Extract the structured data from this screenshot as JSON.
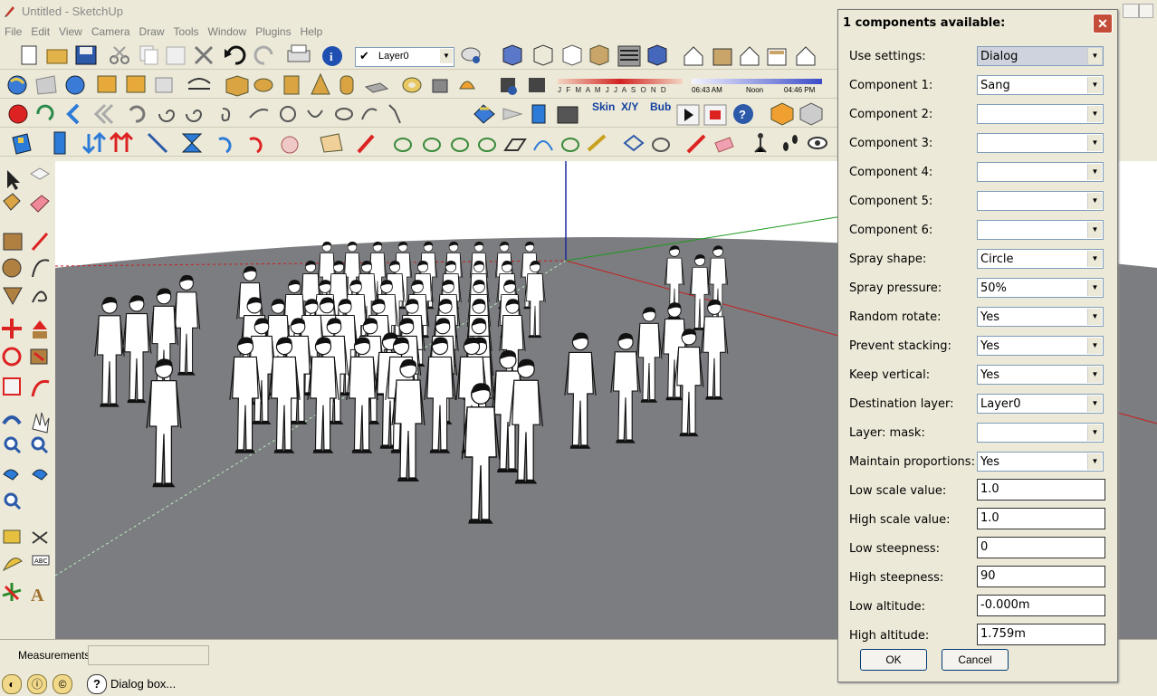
{
  "window": {
    "title": "Untitled - SketchUp"
  },
  "menu": [
    "File",
    "Edit",
    "View",
    "Camera",
    "Draw",
    "Tools",
    "Window",
    "Plugins",
    "Help"
  ],
  "toolbar": {
    "layer": "Layer0",
    "months": "J F M A M J J A S O N D",
    "time_start": "06:43 AM",
    "time_noon": "Noon",
    "time_end": "04:46 PM",
    "skin_label": "Skin",
    "xyz_label": "X/Y",
    "bub_label": "Bub"
  },
  "icons": {
    "left_toolbar": [
      "select-icon",
      "eraser-icon",
      "paint-bucket-icon",
      "erase-icon",
      "rectangle-icon",
      "pencil-icon",
      "circle-icon",
      "arc-icon",
      "polygon-icon",
      "freehand-icon",
      "move-icon",
      "push-pull-icon",
      "rotate-icon",
      "follow-me-icon",
      "scale-icon",
      "offset-icon",
      "orbit-icon",
      "pan-icon",
      "zoom-icon",
      "zoom-window-icon",
      "previous-view-icon",
      "next-view-icon",
      "zoom-extents-icon",
      "tape-measure-icon",
      "dimension-icon",
      "protractor-icon",
      "text-icon",
      "axes-icon",
      "3d-text-icon"
    ]
  },
  "status": {
    "measurements_label": "Measurements",
    "measurements_value": "",
    "message": "Dialog box..."
  },
  "dialog": {
    "title": "1 components available:",
    "rows": [
      {
        "label": "Use settings:",
        "value": "Dialog",
        "type": "select"
      },
      {
        "label": "Component 1:",
        "value": "Sang",
        "type": "select"
      },
      {
        "label": "Component 2:",
        "value": "",
        "type": "select"
      },
      {
        "label": "Component 3:",
        "value": "",
        "type": "select"
      },
      {
        "label": "Component 4:",
        "value": "",
        "type": "select"
      },
      {
        "label": "Component 5:",
        "value": "",
        "type": "select"
      },
      {
        "label": "Component 6:",
        "value": "",
        "type": "select"
      },
      {
        "label": "Spray shape:",
        "value": "Circle",
        "type": "select"
      },
      {
        "label": "Spray pressure:",
        "value": "50%",
        "type": "select"
      },
      {
        "label": "Random rotate:",
        "value": "Yes",
        "type": "select"
      },
      {
        "label": "Prevent stacking:",
        "value": "Yes",
        "type": "select"
      },
      {
        "label": "Keep vertical:",
        "value": "Yes",
        "type": "select"
      },
      {
        "label": "Destination layer:",
        "value": "Layer0",
        "type": "select"
      },
      {
        "label": "Layer: mask:",
        "value": "",
        "type": "select"
      },
      {
        "label": "Maintain proportions:",
        "value": "Yes",
        "type": "select"
      },
      {
        "label": "Low scale value:",
        "value": "1.0",
        "type": "input"
      },
      {
        "label": "High scale value:",
        "value": "1.0",
        "type": "input"
      },
      {
        "label": "Low steepness:",
        "value": "0",
        "type": "input"
      },
      {
        "label": "High steepness:",
        "value": "90",
        "type": "input"
      },
      {
        "label": "Low altitude:",
        "value": "-0.000m",
        "type": "input"
      },
      {
        "label": "High altitude:",
        "value": "1.759m",
        "type": "input"
      }
    ],
    "ok_label": "OK",
    "cancel_label": "Cancel"
  },
  "colors": {
    "ground": "#7b7d80",
    "sky": "#ffffff",
    "dialog_bg": "#ece9d8",
    "close_button": "#c34d38"
  }
}
